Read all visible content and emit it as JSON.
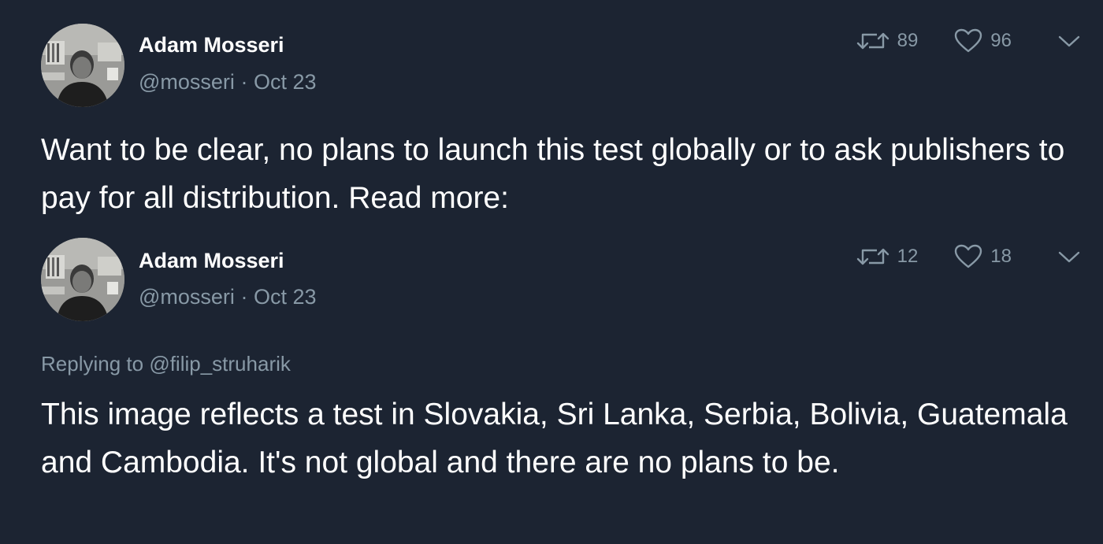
{
  "tweets": [
    {
      "author_name": "Adam Mosseri",
      "handle": "@mosseri",
      "separator": "·",
      "date": "Oct 23",
      "retweets": "89",
      "likes": "96",
      "text": "Want to be clear, no plans to launch this test globally or to ask publishers to pay for all distribution. Read more:"
    },
    {
      "author_name": "Adam Mosseri",
      "handle": "@mosseri",
      "separator": "·",
      "date": "Oct 23",
      "retweets": "12",
      "likes": "18",
      "reply_prefix": "Replying to",
      "reply_to": "@filip_struharik",
      "text": "This image reflects a test in Slovakia, Sri Lanka, Serbia, Bolivia, Guatemala and Cambodia. It's not global and there are no plans to be."
    }
  ],
  "colors": {
    "background": "#1c2432",
    "primary_text": "#ffffff",
    "secondary_text": "#8899a6"
  },
  "icons": {
    "retweet": "retweet-icon",
    "like": "heart-icon",
    "menu": "chevron-down-icon",
    "avatar": "avatar"
  }
}
